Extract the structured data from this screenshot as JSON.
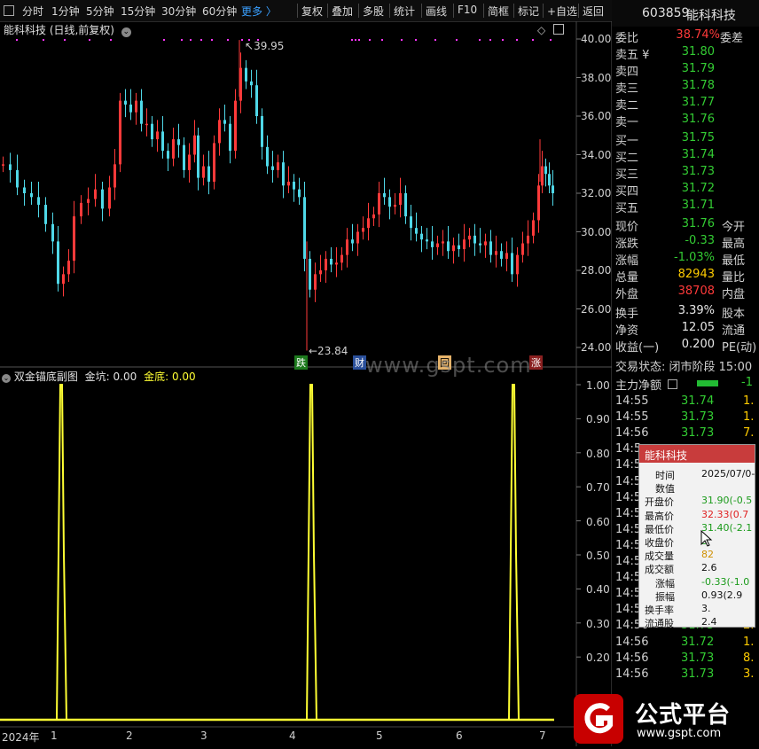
{
  "toolbar": {
    "left_items": [
      "分时",
      "1分钟",
      "5分钟",
      "15分钟",
      "30分钟",
      "60分钟",
      "更多 〉"
    ],
    "right_items": [
      "复权",
      "叠加",
      "多股",
      "统计",
      "画线",
      "F10",
      "简框",
      "标记",
      "+自选",
      "返回"
    ]
  },
  "chart_title": "能科科技 (日线,前复权)",
  "price_axis": [
    "40.00",
    "38.00",
    "36.00",
    "34.00",
    "32.00",
    "30.00",
    "28.00",
    "26.00",
    "24.00"
  ],
  "annotations": {
    "high": "39.95",
    "low": "←23.84"
  },
  "event_tags": [
    "跌",
    "财",
    "回",
    "涨"
  ],
  "watermark": "www.gspt.com",
  "indicator": {
    "name": "双金锚底副图",
    "field1_label": "金坑:",
    "field1_value": "0.00",
    "field2_label": "金底:",
    "field2_value": "0.00",
    "axis": [
      "1.00",
      "0.90",
      "0.80",
      "0.70",
      "0.60",
      "0.50",
      "0.40",
      "0.30",
      "0.20"
    ]
  },
  "time_axis": [
    "2024年",
    "1",
    "2",
    "3",
    "4",
    "5",
    "6",
    "7"
  ],
  "right_panel": {
    "code": "603859",
    "name": "能科科技",
    "weibi_label": "委比",
    "weibi_value": "38.74%",
    "weicha_label": "委差",
    "asks": [
      {
        "label": "卖五 ¥",
        "price": "31.80"
      },
      {
        "label": "卖四",
        "price": "31.79"
      },
      {
        "label": "卖三",
        "price": "31.78"
      },
      {
        "label": "卖二",
        "price": "31.77"
      },
      {
        "label": "卖一",
        "price": "31.76"
      }
    ],
    "bids": [
      {
        "label": "买一",
        "price": "31.75"
      },
      {
        "label": "买二",
        "price": "31.74"
      },
      {
        "label": "买三",
        "price": "31.73"
      },
      {
        "label": "买四",
        "price": "31.72"
      },
      {
        "label": "买五",
        "price": "31.71"
      }
    ],
    "quotes": [
      {
        "label": "现价",
        "value": "31.76",
        "label2": "今开",
        "color": "green"
      },
      {
        "label": "涨跌",
        "value": "-0.33",
        "label2": "最高",
        "color": "green"
      },
      {
        "label": "涨幅",
        "value": "-1.03%",
        "label2": "最低",
        "color": "green"
      },
      {
        "label": "总量",
        "value": "82943",
        "label2": "量比",
        "color": "yellow"
      },
      {
        "label": "外盘",
        "value": "38708",
        "label2": "内盘",
        "color": "red"
      }
    ],
    "stats": [
      {
        "label": "换手",
        "value": "3.39%",
        "label2": "股本"
      },
      {
        "label": "净资",
        "value": "12.05",
        "label2": "流通"
      },
      {
        "label": "收益(一)",
        "value": "0.200",
        "label2": "PE(动)"
      }
    ],
    "trade_status": "交易状态: 闭市阶段 15:00",
    "main_flow_label": "主力净额",
    "main_flow_value": "-1",
    "ticks": [
      {
        "time": "14:55",
        "price": "31.74",
        "vol": "1."
      },
      {
        "time": "14:55",
        "price": "31.73",
        "vol": "1."
      },
      {
        "time": "14:56",
        "price": "31.73",
        "vol": "7."
      },
      {
        "time": "14:5",
        "price": "",
        "vol": ""
      },
      {
        "time": "14:5",
        "price": "",
        "vol": ""
      },
      {
        "time": "14:5",
        "price": "",
        "vol": ""
      },
      {
        "time": "14:5",
        "price": "",
        "vol": ""
      },
      {
        "time": "14:5",
        "price": "",
        "vol": ""
      },
      {
        "time": "14:5",
        "price": "",
        "vol": ""
      },
      {
        "time": "14:5",
        "price": "",
        "vol": ""
      },
      {
        "time": "14:5",
        "price": "",
        "vol": ""
      },
      {
        "time": "14:5",
        "price": "",
        "vol": ""
      },
      {
        "time": "14:5",
        "price": "",
        "vol": ""
      },
      {
        "time": "14:5",
        "price": "",
        "vol": ""
      },
      {
        "time": "14:56",
        "price": "31.73",
        "vol": "2."
      },
      {
        "time": "14:56",
        "price": "31.72",
        "vol": "1."
      },
      {
        "time": "14:56",
        "price": "31.73",
        "vol": "8."
      },
      {
        "time": "14:56",
        "price": "31.73",
        "vol": "3."
      }
    ]
  },
  "tooltip": {
    "title": "能科科技",
    "rows": [
      {
        "label": "时间",
        "value": "2025/07/0-"
      },
      {
        "label": "数值",
        "value": ""
      },
      {
        "label": "开盘价",
        "value": "31.90(-0.5"
      },
      {
        "label": "最高价",
        "value": "32.33(0.7"
      },
      {
        "label": "最低价",
        "value": "31.40(-2.1"
      },
      {
        "label": "收盘价",
        "value": "3"
      },
      {
        "label": "成交量",
        "value": "82"
      },
      {
        "label": "成交额",
        "value": "2.6"
      },
      {
        "label": "涨幅",
        "value": "-0.33(-1.0"
      },
      {
        "label": "振幅",
        "value": "0.93(2.9"
      },
      {
        "label": "换手率",
        "value": "3."
      },
      {
        "label": "流通股",
        "value": "2.4"
      }
    ]
  },
  "logo": {
    "title": "公式平台",
    "url": "www.gspt.com"
  },
  "colors": {
    "up": "#ff3a3a",
    "down": "#4fd8e8",
    "yellow": "#ffff33",
    "magenta": "#ff33ff"
  }
}
